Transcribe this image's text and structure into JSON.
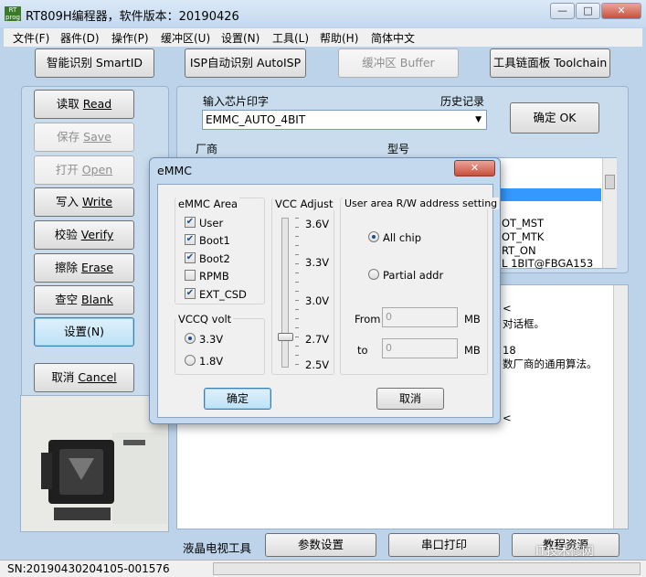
{
  "window": {
    "title": "RT809H编程器，软件版本：20190426",
    "app_icon_text": "RT prog",
    "min_glyph": "—",
    "max_glyph": "□",
    "close_glyph": "✕"
  },
  "menu": [
    "文件(F)",
    "器件(D)",
    "操作(P)",
    "缓冲区(U)",
    "设置(N)",
    "工具(L)",
    "帮助(H)",
    "简体中文"
  ],
  "toolbar": {
    "smartid": "智能识别 SmartID",
    "autoisp": "ISP自动识别 AutoISP",
    "buffer": "缓冲区 Buffer",
    "toolchain": "工具链面板 Toolchain"
  },
  "side_buttons": {
    "read": {
      "cn": "读取 ",
      "en": "Read"
    },
    "save": {
      "cn": "保存 ",
      "en": "Save"
    },
    "open": {
      "cn": "打开 ",
      "en": "Open"
    },
    "write": {
      "cn": "写入 ",
      "en": "Write"
    },
    "verify": {
      "cn": "校验 ",
      "en": "Verify"
    },
    "erase": {
      "cn": "擦除 ",
      "en": "Erase"
    },
    "blank": {
      "cn": "查空 ",
      "en": "Blank"
    },
    "settings": "设置(N)",
    "cancel": {
      "cn": "取消 ",
      "en": "Cancel"
    }
  },
  "chip_panel": {
    "input_label": "输入芯片印字",
    "history_label": "历史记录",
    "chip_value": "EMMC_AUTO_4BIT",
    "ok_button": "确定 OK",
    "vendor_header": "厂商",
    "model_header": "型号",
    "models": [
      "OT_MST",
      "OT_MTK",
      "RT_ON",
      "L 1BIT@FBGA153"
    ]
  },
  "log_fragments": [
    "<",
    "对话框。",
    "18",
    "数厂商的通用算法。",
    "<"
  ],
  "bottom_buttons": [
    "液晶电视工具",
    "参数设置",
    "串口打印",
    "教程资源"
  ],
  "status": {
    "serial": "SN:20190430204105-001576"
  },
  "watermark": "IT技术修网",
  "dialog": {
    "title": "eMMC",
    "area_group": "eMMC Area",
    "areas": [
      {
        "label": "User",
        "checked": true
      },
      {
        "label": "Boot1",
        "checked": true
      },
      {
        "label": "Boot2",
        "checked": true
      },
      {
        "label": "RPMB",
        "checked": false
      },
      {
        "label": "EXT_CSD",
        "checked": true
      }
    ],
    "vccq_group": "VCCQ volt",
    "vccq_options": [
      {
        "label": "3.3V",
        "selected": true
      },
      {
        "label": "1.8V",
        "selected": false
      }
    ],
    "vcc_group": "VCC Adjust",
    "vcc_ticks": [
      "3.6V",
      "3.3V",
      "3.0V",
      "2.7V",
      "2.5V"
    ],
    "rw_group": "User area R/W address setting",
    "rw_options": [
      {
        "label": "All chip",
        "selected": true
      },
      {
        "label": "Partial addr",
        "selected": false
      }
    ],
    "from_label": "From",
    "from_value": "0",
    "to_label": "to",
    "to_value": "0",
    "unit": "MB",
    "ok": "确定",
    "cancel": "取消"
  }
}
